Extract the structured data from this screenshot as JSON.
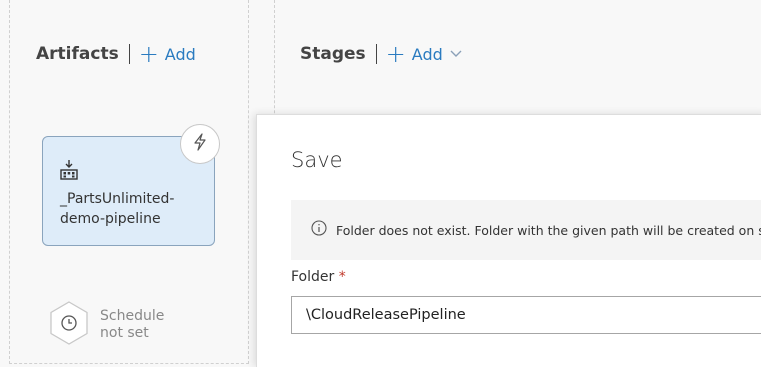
{
  "artifacts": {
    "title": "Artifacts",
    "add_label": "Add",
    "card": {
      "name_line1": "_PartsUnlimited-",
      "name_line2": "demo-pipeline",
      "build_icon": "build-pipeline-icon",
      "trigger_icon": "lightning-icon"
    },
    "schedule": {
      "line1": "Schedule",
      "line2": "not set",
      "icon": "clock-icon"
    }
  },
  "stages": {
    "title": "Stages",
    "add_label": "Add"
  },
  "save_panel": {
    "title": "Save",
    "info_message": "Folder does not exist. Folder with the given path will be created on save.",
    "info_icon": "info-icon",
    "folder_label": "Folder",
    "required_marker": "*",
    "folder_value": "\\CloudReleasePipeline"
  },
  "colors": {
    "accent": "#2a7bc0",
    "card_bg": "#deecf9",
    "required": "#c0392b"
  }
}
